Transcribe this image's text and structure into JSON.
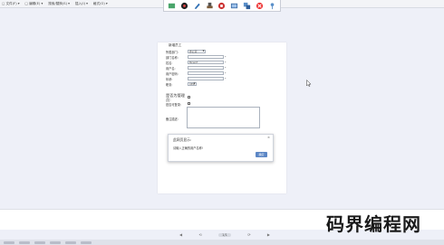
{
  "menubar": {
    "items": [
      "▢ 文件(F) ▾",
      "□ 编辑(E) ▾",
      "搜索/替换(S) ▾",
      "插入(I) ▾",
      "格式(O) ▾"
    ]
  },
  "toolbar": {
    "icons": [
      "screen-icon",
      "record-icon",
      "pen-icon",
      "stamp-icon",
      "stop-icon",
      "image-icon",
      "share-icon",
      "close-icon",
      "pin-icon"
    ]
  },
  "form": {
    "title": "新增员工",
    "fields": [
      {
        "label": "所属部门:",
        "value": "办公室",
        "type": "select"
      },
      {
        "label": "部门名称:",
        "value": "",
        "type": "input"
      },
      {
        "label": "姓名:",
        "value": "Mcsmf",
        "type": "input"
      },
      {
        "label": "用户名:",
        "value": "",
        "type": "input"
      },
      {
        "label": "用户密码:",
        "value": "",
        "type": "input"
      },
      {
        "label": "年龄:",
        "value": "",
        "type": "input"
      },
      {
        "label": "职务:",
        "value": "CEO",
        "type": "select"
      }
    ],
    "section_title": "是否为管理员:",
    "option_label": "是否可登录:",
    "note_label": "备注描述:"
  },
  "dialog": {
    "title": "此网页显示:",
    "message": "请输入正确的用户名称!",
    "ok_label": "确定",
    "close_glyph": "×"
  },
  "pagenav": {
    "prev": "◀",
    "first": "⟲",
    "page": "1/1",
    "next": "▶",
    "last": "⟳"
  },
  "watermark": "码界编程网",
  "colors": {
    "background": "#eef0f8",
    "button": "#5b86c5"
  }
}
